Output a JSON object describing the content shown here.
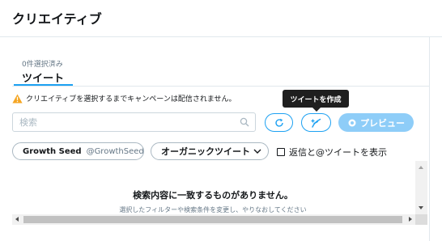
{
  "header": {
    "title": "クリエイティブ"
  },
  "tabs": {
    "selected_count": "0件選択済み",
    "active_label": "ツイート"
  },
  "warning": {
    "text": "クリエイティブを選択するまでキャンペーンは配信されません。",
    "color": "#f5a623"
  },
  "toolbar": {
    "search_placeholder": "検索",
    "compose_tooltip": "ツイートを作成",
    "preview_label": "プレビュー",
    "accent_color": "#1da1f2"
  },
  "filters": {
    "account_name": "Growth Seed",
    "account_handle": "@GrowthSeed",
    "tweet_type": "オーガニックツイート",
    "show_replies_label": "返信と@ツイートを表示",
    "show_replies_checked": false
  },
  "results": {
    "empty_title": "検索内容に一致するものがありません。",
    "empty_subtitle": "選択したフィルターや検索条件を変更し、やりなおしてください"
  }
}
